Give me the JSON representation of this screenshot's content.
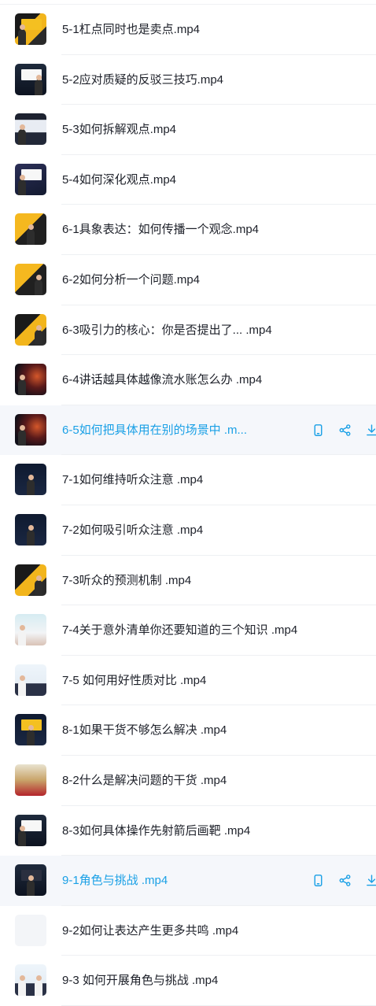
{
  "files": [
    {
      "name": "5-1杠点同时也是卖点.mp4",
      "thumb": "t-yellow",
      "figs": [
        "left"
      ],
      "slide": "yellow"
    },
    {
      "name": "5-2应对质疑的反驳三技巧.mp4",
      "thumb": "t-dark",
      "figs": [
        "right"
      ],
      "slide": "light"
    },
    {
      "name": "5-3如何拆解观点.mp4",
      "thumb": "t-screen",
      "figs": [
        "left"
      ],
      "slide": ""
    },
    {
      "name": "5-4如何深化观点.mp4",
      "thumb": "t-purple",
      "figs": [
        "left"
      ],
      "slide": "light"
    },
    {
      "name": "6-1具象表达：如何传播一个观念.mp4",
      "thumb": "t-orange",
      "figs": [
        "mid"
      ],
      "slide": ""
    },
    {
      "name": "6-2如何分析一个问题.mp4",
      "thumb": "t-orange",
      "figs": [
        "right"
      ],
      "slide": ""
    },
    {
      "name": "6-3吸引力的核心：你是否提出了... .mp4",
      "thumb": "t-yellow",
      "figs": [
        "right"
      ],
      "slide": ""
    },
    {
      "name": "6-4讲话越具体越像流水账怎么办 .mp4",
      "thumb": "t-red",
      "figs": [
        "left"
      ],
      "slide": ""
    },
    {
      "name": "6-5如何把具体用在别的场景中 .m...",
      "thumb": "t-red",
      "figs": [
        "left"
      ],
      "slide": "",
      "hovered": true
    },
    {
      "name": "7-1如何维持听众注意 .mp4",
      "thumb": "t-navy",
      "figs": [
        "mid"
      ],
      "slide": ""
    },
    {
      "name": "7-2如何吸引听众注意 .mp4",
      "thumb": "t-navy",
      "figs": [
        "mid"
      ],
      "slide": ""
    },
    {
      "name": "7-3听众的预测机制 .mp4",
      "thumb": "t-yellow",
      "figs": [
        "right"
      ],
      "slide": ""
    },
    {
      "name": "7-4关于意外清单你还要知道的三个知识 .mp4",
      "thumb": "t-light",
      "figs": [
        "left"
      ],
      "slide": ""
    },
    {
      "name": "7-5 如何用好性质对比 .mp4",
      "thumb": "t-white",
      "figs": [
        "left"
      ],
      "slide": ""
    },
    {
      "name": "8-1如果干货不够怎么解决 .mp4",
      "thumb": "t-navy",
      "figs": [
        "mid"
      ],
      "slide": "yellow"
    },
    {
      "name": "8-2什么是解决问题的干货 .mp4",
      "thumb": "t-colorful",
      "figs": [],
      "slide": ""
    },
    {
      "name": "8-3如何具体操作先射箭后画靶 .mp4",
      "thumb": "t-dark",
      "figs": [
        "left"
      ],
      "slide": "light"
    },
    {
      "name": "9-1角色与挑战 .mp4",
      "thumb": "t-dark",
      "figs": [
        "mid"
      ],
      "slide": "dark",
      "hovered": true
    },
    {
      "name": "9-2如何让表达产生更多共鸣 .mp4",
      "thumb": "t-empty",
      "figs": [],
      "slide": ""
    },
    {
      "name": "9-3 如何开展角色与挑战 .mp4",
      "thumb": "t-white",
      "figs": [
        "left",
        "right"
      ],
      "slide": ""
    }
  ],
  "row_actions": [
    {
      "icon": "phone-icon"
    },
    {
      "icon": "share-icon"
    },
    {
      "icon": "download-icon"
    }
  ],
  "colors": {
    "accent": "#1aa0e6",
    "text": "#1d2029",
    "hover_bg": "#f5f7fb"
  }
}
